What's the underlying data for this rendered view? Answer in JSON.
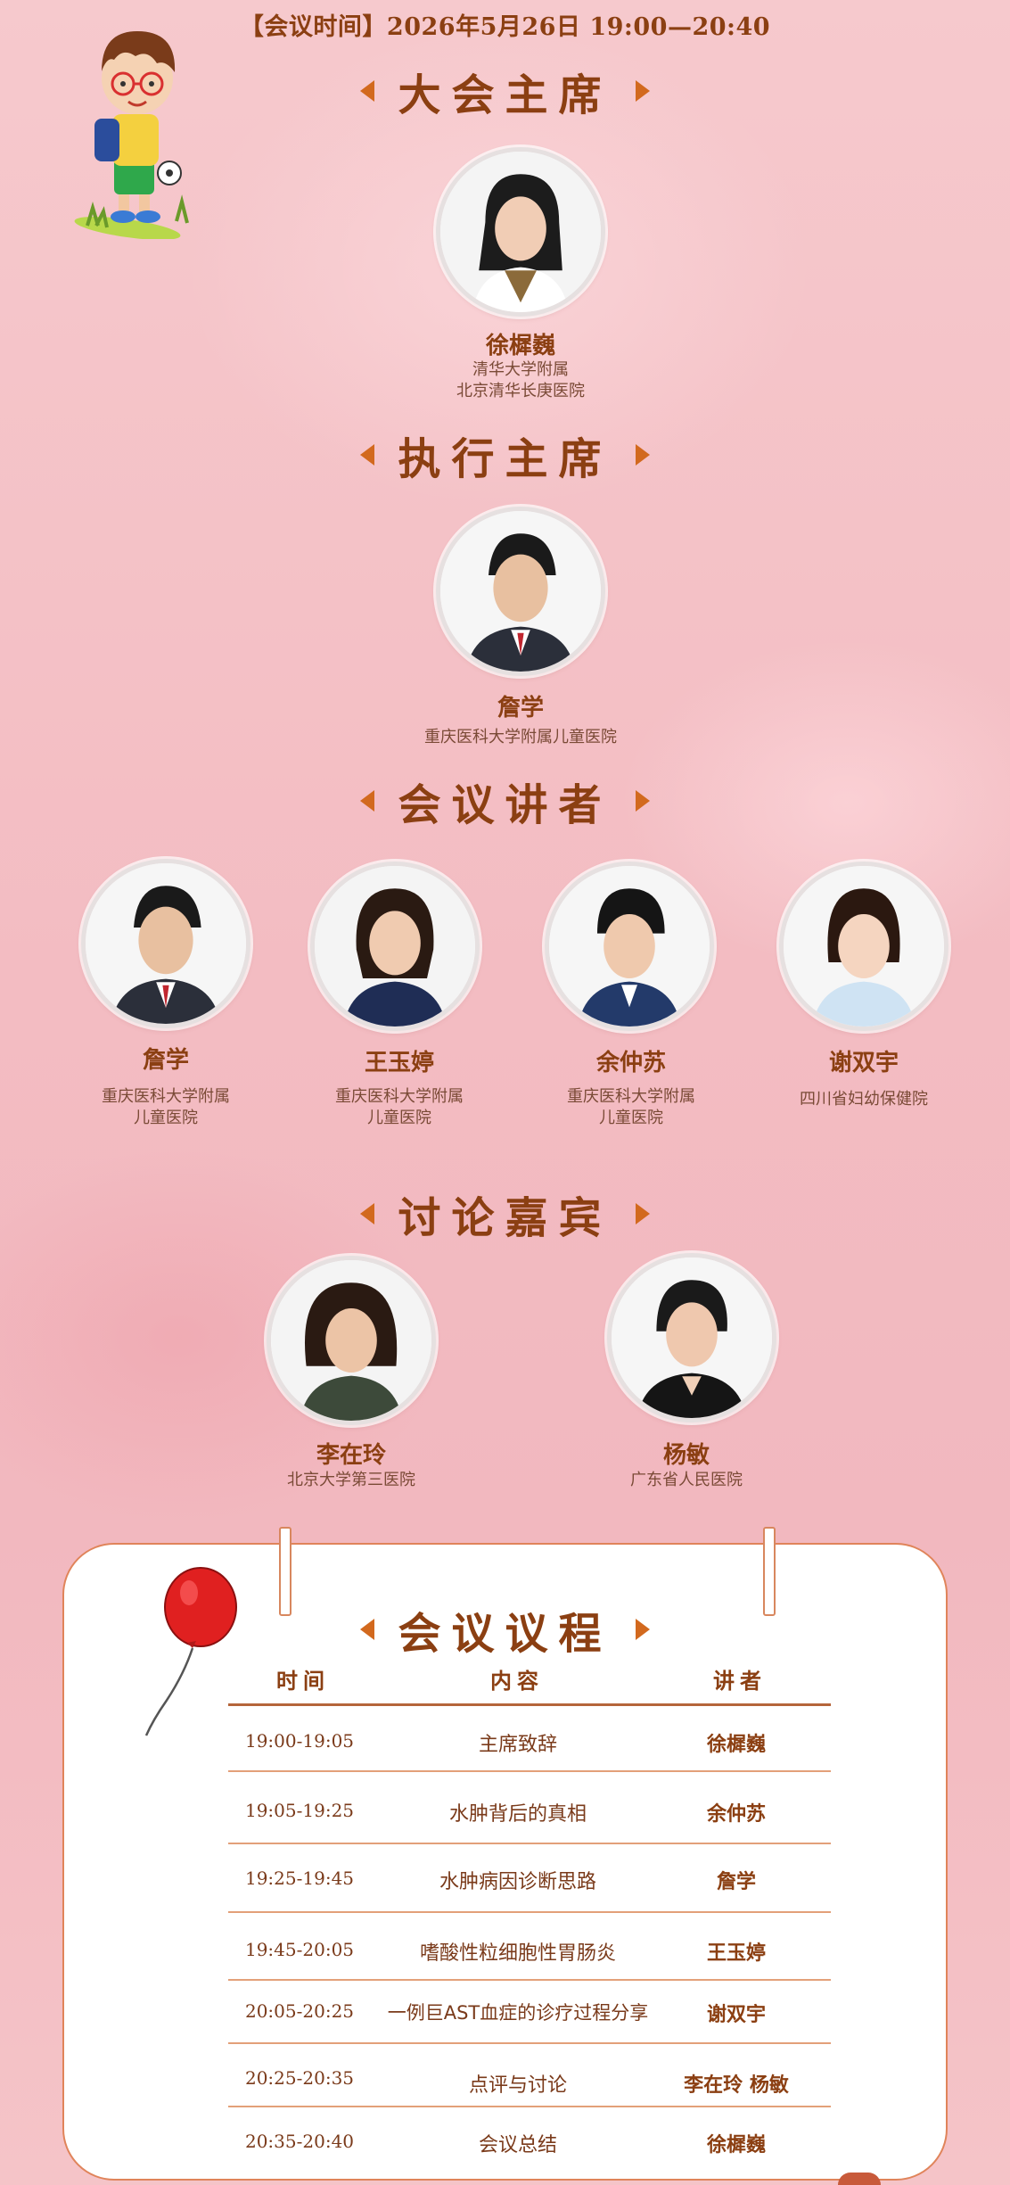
{
  "meeting_time": "【会议时间】2026年5月26日  19:00—20:40",
  "sections": {
    "chair": "大会主席",
    "exec_chair": "执行主席",
    "speakers": "会议讲者",
    "panel": "讨论嘉宾",
    "agenda": "会议议程"
  },
  "chair": {
    "name": "徐樨巍",
    "org1": "清华大学附属",
    "org2": "北京清华长庚医院"
  },
  "exec_chair": {
    "name": "詹学",
    "org1": "重庆医科大学附属儿童医院"
  },
  "speakers": [
    {
      "name": "詹学",
      "org1": "重庆医科大学附属",
      "org2": "儿童医院"
    },
    {
      "name": "王玉婷",
      "org1": "重庆医科大学附属",
      "org2": "儿童医院"
    },
    {
      "name": "余仲苏",
      "org1": "重庆医科大学附属",
      "org2": "儿童医院"
    },
    {
      "name": "谢双宇",
      "org1": "四川省妇幼保健院",
      "org2": ""
    }
  ],
  "panel": [
    {
      "name": "李在玲",
      "org1": "北京大学第三医院"
    },
    {
      "name": "杨敏",
      "org1": "广东省人民医院"
    }
  ],
  "agenda": {
    "headers": {
      "time": "时间",
      "content": "内容",
      "speaker": "讲者"
    },
    "rows": [
      {
        "time": "19:00-19:05",
        "content": "主席致辞",
        "speaker": "徐樨巍"
      },
      {
        "time": "19:05-19:25",
        "content": "水肿背后的真相",
        "speaker": "余仲苏"
      },
      {
        "time": "19:25-19:45",
        "content": "水肿病因诊断思路",
        "speaker": "詹学"
      },
      {
        "time": "19:45-20:05",
        "content": "嗜酸性粒细胞性胃肠炎",
        "speaker": "王玉婷"
      },
      {
        "time": "20:05-20:25",
        "content": "一例巨AST血症的诊疗过程分享",
        "speaker": "谢双宇"
      },
      {
        "time": "20:25-20:35",
        "content": "点评与讨论",
        "speaker": "李在玲 杨敏"
      },
      {
        "time": "20:35-20:40",
        "content": "会议总结",
        "speaker": "徐樨巍"
      }
    ]
  },
  "colors": {
    "title": "#8b3f12",
    "accent": "#d2691e",
    "balloon": "#e02020",
    "background": "#f3bcc2"
  }
}
